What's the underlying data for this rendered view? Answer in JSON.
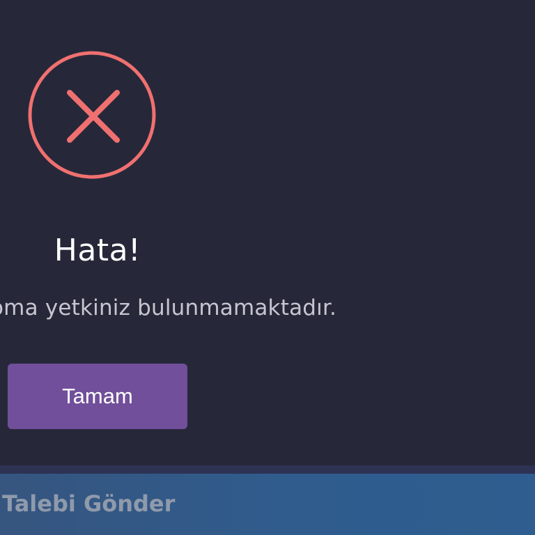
{
  "dialog": {
    "icon": "error-x-icon",
    "title": "Hata!",
    "message": "oma yetkiniz bulunmamaktadır.",
    "ok_label": "Tamam",
    "colors": {
      "background": "#262839",
      "icon": "#f07070",
      "button": "#714f9a"
    }
  },
  "background_page": {
    "submit_label": "Talebi Gönder"
  }
}
